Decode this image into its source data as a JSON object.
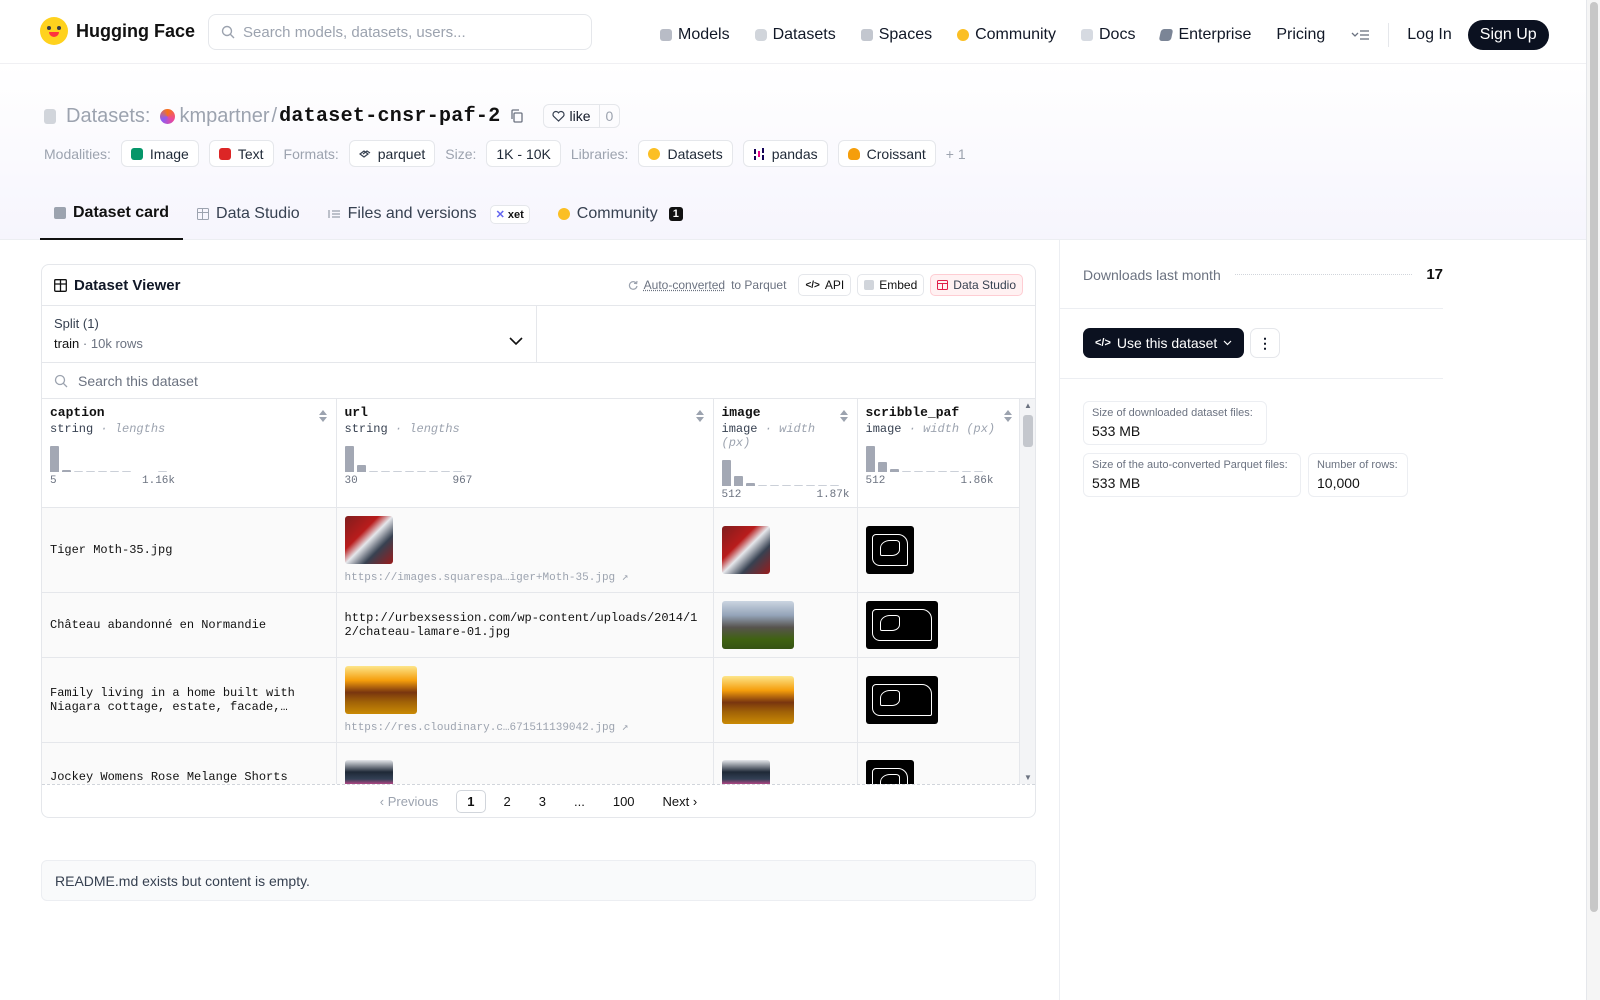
{
  "nav": {
    "logo_text": "Hugging Face",
    "search_placeholder": "Search models, datasets, users...",
    "links": [
      {
        "label": "Models",
        "icon": "cube-icon",
        "color": "#9ca3af"
      },
      {
        "label": "Datasets",
        "icon": "database-icon",
        "color": "#d1d5db"
      },
      {
        "label": "Spaces",
        "icon": "grid-icon",
        "color": "#9ca3af"
      },
      {
        "label": "Community",
        "icon": "community-icon",
        "color": "#fbbf24"
      },
      {
        "label": "Docs",
        "icon": "book-icon",
        "color": "#cbd5e1"
      },
      {
        "label": "Enterprise",
        "icon": "enterprise-icon",
        "color": "#64748b"
      },
      {
        "label": "Pricing",
        "icon": "",
        "color": ""
      }
    ],
    "login": "Log In",
    "signup": "Sign Up"
  },
  "header": {
    "section": "Datasets:",
    "owner": "kmpartner",
    "separator": "/",
    "name": "dataset-cnsr-paf-2",
    "like_label": "like",
    "like_count": "0",
    "modalities_label": "Modalities:",
    "modalities": [
      {
        "label": "Image",
        "color": "#10b981"
      },
      {
        "label": "Text",
        "color": "#ef4444"
      }
    ],
    "formats_label": "Formats:",
    "format": "parquet",
    "size_label": "Size:",
    "size": "1K - 10K",
    "libraries_label": "Libraries:",
    "libraries": [
      {
        "label": "Datasets",
        "color": "#fbbf24"
      },
      {
        "label": "pandas",
        "color": "#150458"
      },
      {
        "label": "Croissant",
        "color": "#f59e0b"
      }
    ],
    "more": "+ 1"
  },
  "tabs": [
    {
      "label": "Dataset card",
      "active": true
    },
    {
      "label": "Data Studio"
    },
    {
      "label": "Files and versions",
      "badge": "xet"
    },
    {
      "label": "Community",
      "count": "1"
    }
  ],
  "viewer": {
    "title": "Dataset Viewer",
    "auto_converted": "Auto-converted",
    "to_parquet": "to Parquet",
    "api": "API",
    "embed": "Embed",
    "data_studio": "Data Studio",
    "split_label": "Split (1)",
    "split_value": "train",
    "split_rows": "10k rows",
    "search_placeholder": "Search this dataset",
    "columns": [
      {
        "name": "caption",
        "type": "string",
        "stat": "lengths",
        "min": "5",
        "max": "1.16k",
        "hist": [
          1.0,
          0.08,
          0.05,
          0.05,
          0.05,
          0.05,
          0.05,
          0,
          0,
          0.05
        ]
      },
      {
        "name": "url",
        "type": "string",
        "stat": "lengths",
        "min": "30",
        "max": "967",
        "hist": [
          1.0,
          0.25,
          0.06,
          0.05,
          0.05,
          0.05,
          0.05,
          0.05,
          0.05,
          0.05
        ]
      },
      {
        "name": "image",
        "type": "image",
        "stat": "width (px)",
        "min": "512",
        "max": "1.87k",
        "hist": [
          1.0,
          0.4,
          0.12,
          0.05,
          0.05,
          0.05,
          0.05,
          0.05,
          0.05,
          0.05
        ]
      },
      {
        "name": "scribble_paf",
        "type": "image",
        "stat": "width (px)",
        "min": "512",
        "max": "1.86k",
        "hist": [
          1.0,
          0.4,
          0.12,
          0.05,
          0.05,
          0.05,
          0.05,
          0.05,
          0.05,
          0.05
        ]
      }
    ],
    "rows": [
      {
        "caption": "Tiger Moth-35.jpg",
        "url": "https://images.squarespa…iger+Moth-35.jpg",
        "url_is_image": true
      },
      {
        "caption": "Château abandonné en Normandie",
        "url": "http://urbexsession.com/wp-content/uploads/2014/12/chateau-lamare-01.jpg",
        "url_is_image": false
      },
      {
        "caption": "Family living in a home built with Niagara cottage, estate, facade,…",
        "url": "https://res.cloudinary.c…671511139042.jpg",
        "url_is_image": true
      },
      {
        "caption": "Jockey Womens Rose Melange Shorts (S,Rose Melange)",
        "url": "",
        "url_is_image": true
      }
    ],
    "pager": {
      "prev": "Previous",
      "pages": [
        "1",
        "2",
        "3",
        "...",
        "100"
      ],
      "next": "Next"
    }
  },
  "readme_text": "README.md exists but content is empty.",
  "sidebar": {
    "downloads_label": "Downloads last month",
    "downloads_value": "17",
    "use_button": "Use this dataset",
    "stats": [
      {
        "label": "Size of downloaded dataset files:",
        "value": "533 MB"
      },
      {
        "label": "Size of the auto-converted Parquet files:",
        "value": "533 MB"
      },
      {
        "label": "Number of rows:",
        "value": "10,000"
      }
    ]
  }
}
